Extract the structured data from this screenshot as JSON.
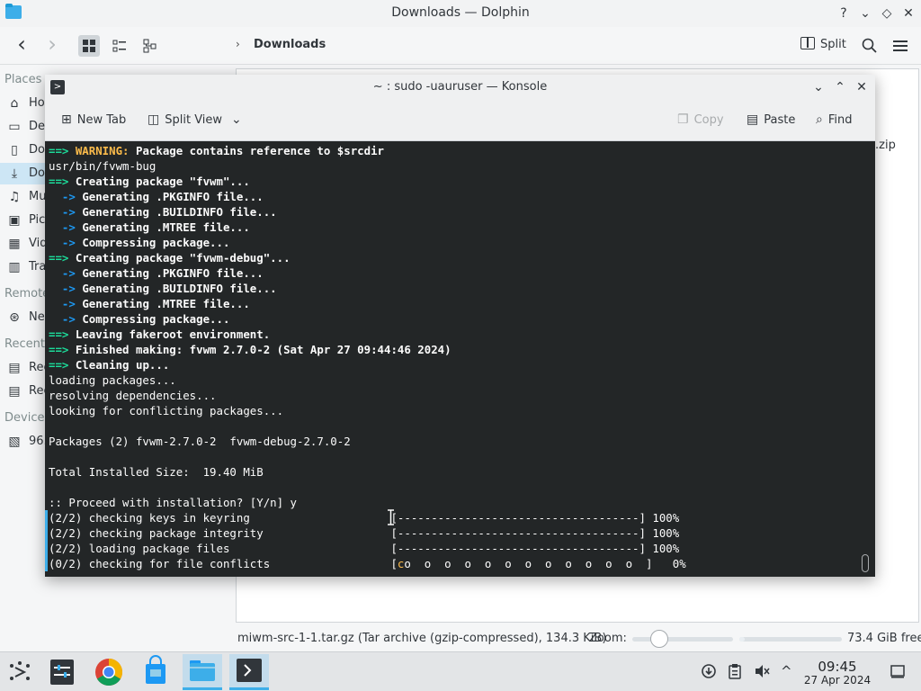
{
  "dolphin": {
    "title": "Downloads — Dolphin",
    "title_controls": {
      "help": "?",
      "minimize": "⌄",
      "maximize": "◇",
      "close": "✕"
    },
    "toolbar": {
      "back": "‹",
      "forward": "›",
      "breadcrumb_separator": "›",
      "breadcrumb": "Downloads",
      "split_label": "Split",
      "search_icon": "⌕",
      "menu_icon": "≡",
      "view_modes": [
        "icons",
        "compact",
        "details"
      ],
      "active_view_mode": "icons"
    },
    "places": {
      "places_header": "Places",
      "remote_header": "Remote",
      "recent_header": "Recent",
      "devices_header": "Devices",
      "items": [
        {
          "label": "Ho",
          "icon": "home-icon"
        },
        {
          "label": "De",
          "icon": "desktop-icon"
        },
        {
          "label": "Do",
          "icon": "documents-icon"
        },
        {
          "label": "Do",
          "icon": "downloads-icon",
          "selected": true
        },
        {
          "label": "Mu",
          "icon": "music-icon"
        },
        {
          "label": "Pic",
          "icon": "pictures-icon"
        },
        {
          "label": "Vid",
          "icon": "videos-icon"
        },
        {
          "label": "Tra",
          "icon": "trash-icon"
        },
        {
          "label": "Ne",
          "icon": "network-icon"
        },
        {
          "label": "Rec",
          "icon": "recent-files-icon"
        },
        {
          "label": "Rec",
          "icon": "recent-locations-icon"
        },
        {
          "label": "96.",
          "icon": "drive-icon"
        }
      ]
    },
    "file_peek": ".zip",
    "statusbar": {
      "selection": "miwm-src-1-1.tar.gz (Tar archive (gzip-compressed), 134.3 KiB)",
      "zoom_label": "Zoom:",
      "free_space": "73.4 GiB free",
      "zoom_level": 0.2,
      "disk_used_fraction": 0.05
    }
  },
  "konsole": {
    "title": "~ : sudo -uauruser — Konsole",
    "controls": {
      "minimize": "⌄",
      "maximize": "⌃",
      "close": "✕"
    },
    "toolbar": {
      "new_tab": "New Tab",
      "split_view": "Split View",
      "copy": "Copy",
      "paste": "Paste",
      "find": "Find"
    },
    "terminal": {
      "lines": [
        {
          "prefix": "==> ",
          "style": "warn-line",
          "warn": "WARNING:",
          "text": " Package contains reference to $srcdir"
        },
        {
          "text": "usr/bin/fvwm-bug"
        },
        {
          "prefix": "==> ",
          "style": "bold-line",
          "text": "Creating package \"fvwm\"..."
        },
        {
          "prefix": "  -> ",
          "style": "sub-line",
          "text": "Generating .PKGINFO file..."
        },
        {
          "prefix": "  -> ",
          "style": "sub-line",
          "text": "Generating .BUILDINFO file..."
        },
        {
          "prefix": "  -> ",
          "style": "sub-line",
          "text": "Generating .MTREE file..."
        },
        {
          "prefix": "  -> ",
          "style": "sub-line",
          "text": "Compressing package..."
        },
        {
          "prefix": "==> ",
          "style": "bold-line",
          "text": "Creating package \"fvwm-debug\"..."
        },
        {
          "prefix": "  -> ",
          "style": "sub-line",
          "text": "Generating .PKGINFO file..."
        },
        {
          "prefix": "  -> ",
          "style": "sub-line",
          "text": "Generating .BUILDINFO file..."
        },
        {
          "prefix": "  -> ",
          "style": "sub-line",
          "text": "Generating .MTREE file..."
        },
        {
          "prefix": "  -> ",
          "style": "sub-line",
          "text": "Compressing package..."
        },
        {
          "prefix": "==> ",
          "style": "bold-line",
          "text": "Leaving fakeroot environment."
        },
        {
          "prefix": "==> ",
          "style": "bold-line",
          "text": "Finished making: fvwm 2.7.0-2 (Sat Apr 27 09:44:46 2024)"
        },
        {
          "prefix": "==> ",
          "style": "bold-line",
          "text": "Cleaning up..."
        },
        {
          "text": "loading packages..."
        },
        {
          "text": "resolving dependencies..."
        },
        {
          "text": "looking for conflicting packages..."
        },
        {
          "text": ""
        },
        {
          "text": "Packages (2) fvwm-2.7.0-2  fvwm-debug-2.7.0-2"
        },
        {
          "text": ""
        },
        {
          "text": "Total Installed Size:  19.40 MiB"
        },
        {
          "text": ""
        },
        {
          "text": ":: Proceed with installation? [Y/n] y"
        },
        {
          "text": "(2/2) checking keys in keyring                     [------------------------------------] 100%"
        },
        {
          "text": "(2/2) checking package integrity                   [------------------------------------] 100%"
        },
        {
          "text": "(2/2) loading package files                        [------------------------------------] 100%"
        },
        {
          "style": "progress-line",
          "text": "(0/2) checking for file conflicts                  [",
          "co": "c",
          "rest": "o  o  o  o  o  o  o  o  o  o  o  o  ]   0%"
        }
      ]
    }
  },
  "taskbar": {
    "clock_time": "09:45",
    "clock_date": "27 Apr 2024",
    "tray_arrow": "^",
    "apps": [
      {
        "name": "application-launcher",
        "active": false
      },
      {
        "name": "system-settings",
        "active": false
      },
      {
        "name": "chrome",
        "active": false
      },
      {
        "name": "discover",
        "active": false
      },
      {
        "name": "dolphin",
        "active": true
      },
      {
        "name": "konsole",
        "active": true
      }
    ]
  },
  "colors": {
    "accent": "#3daee9",
    "terminal_bg": "#232627",
    "arrow_green": "#1cdc9a",
    "arrow_blue": "#1d99f3",
    "warning": "#fdbc4b"
  }
}
